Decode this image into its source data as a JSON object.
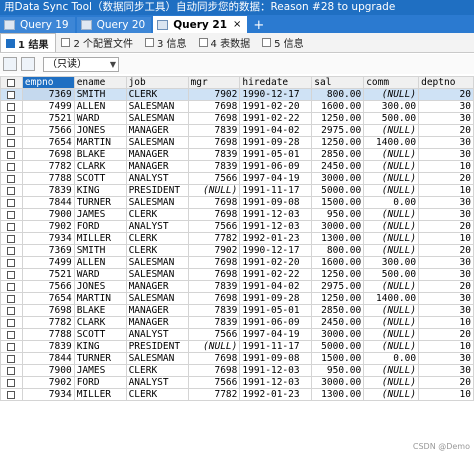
{
  "window": {
    "title": "用Data Sync Tool（数据同步工具）自动同步您的数据：Reason #28 to upgrade"
  },
  "query_tabs": [
    {
      "label": "Query 19",
      "active": false
    },
    {
      "label": "Query 20",
      "active": false
    },
    {
      "label": "Query 21",
      "active": true
    }
  ],
  "query_tab_close": "×",
  "query_tab_add": "+",
  "result_tabs": [
    {
      "label": "1 结果",
      "active": true
    },
    {
      "label": "2 个配置文件",
      "active": false
    },
    {
      "label": "3 信息",
      "active": false
    },
    {
      "label": "4 表数据",
      "active": false
    },
    {
      "label": "5 信息",
      "active": false
    }
  ],
  "toolbar": {
    "mode": "（只读）",
    "arrow": "▼"
  },
  "table": {
    "columns": [
      "empno",
      "ename",
      "job",
      "mgr",
      "hiredate",
      "sal",
      "comm",
      "deptno"
    ],
    "rows": [
      [
        "7369",
        "SMITH",
        "CLERK",
        "7902",
        "1990-12-17",
        "800.00",
        "(NULL)",
        "20"
      ],
      [
        "7499",
        "ALLEN",
        "SALESMAN",
        "7698",
        "1991-02-20",
        "1600.00",
        "300.00",
        "30"
      ],
      [
        "7521",
        "WARD",
        "SALESMAN",
        "7698",
        "1991-02-22",
        "1250.00",
        "500.00",
        "30"
      ],
      [
        "7566",
        "JONES",
        "MANAGER",
        "7839",
        "1991-04-02",
        "2975.00",
        "(NULL)",
        "20"
      ],
      [
        "7654",
        "MARTIN",
        "SALESMAN",
        "7698",
        "1991-09-28",
        "1250.00",
        "1400.00",
        "30"
      ],
      [
        "7698",
        "BLAKE",
        "MANAGER",
        "7839",
        "1991-05-01",
        "2850.00",
        "(NULL)",
        "30"
      ],
      [
        "7782",
        "CLARK",
        "MANAGER",
        "7839",
        "1991-06-09",
        "2450.00",
        "(NULL)",
        "10"
      ],
      [
        "7788",
        "SCOTT",
        "ANALYST",
        "7566",
        "1997-04-19",
        "3000.00",
        "(NULL)",
        "20"
      ],
      [
        "7839",
        "KING",
        "PRESIDENT",
        "(NULL)",
        "1991-11-17",
        "5000.00",
        "(NULL)",
        "10"
      ],
      [
        "7844",
        "TURNER",
        "SALESMAN",
        "7698",
        "1991-09-08",
        "1500.00",
        "0.00",
        "30"
      ],
      [
        "7900",
        "JAMES",
        "CLERK",
        "7698",
        "1991-12-03",
        "950.00",
        "(NULL)",
        "30"
      ],
      [
        "7902",
        "FORD",
        "ANALYST",
        "7566",
        "1991-12-03",
        "3000.00",
        "(NULL)",
        "20"
      ],
      [
        "7934",
        "MILLER",
        "CLERK",
        "7782",
        "1992-01-23",
        "1300.00",
        "(NULL)",
        "10"
      ],
      [
        "7369",
        "SMITH",
        "CLERK",
        "7902",
        "1990-12-17",
        "800.00",
        "(NULL)",
        "20"
      ],
      [
        "7499",
        "ALLEN",
        "SALESMAN",
        "7698",
        "1991-02-20",
        "1600.00",
        "300.00",
        "30"
      ],
      [
        "7521",
        "WARD",
        "SALESMAN",
        "7698",
        "1991-02-22",
        "1250.00",
        "500.00",
        "30"
      ],
      [
        "7566",
        "JONES",
        "MANAGER",
        "7839",
        "1991-04-02",
        "2975.00",
        "(NULL)",
        "20"
      ],
      [
        "7654",
        "MARTIN",
        "SALESMAN",
        "7698",
        "1991-09-28",
        "1250.00",
        "1400.00",
        "30"
      ],
      [
        "7698",
        "BLAKE",
        "MANAGER",
        "7839",
        "1991-05-01",
        "2850.00",
        "(NULL)",
        "30"
      ],
      [
        "7782",
        "CLARK",
        "MANAGER",
        "7839",
        "1991-06-09",
        "2450.00",
        "(NULL)",
        "10"
      ],
      [
        "7788",
        "SCOTT",
        "ANALYST",
        "7566",
        "1997-04-19",
        "3000.00",
        "(NULL)",
        "20"
      ],
      [
        "7839",
        "KING",
        "PRESIDENT",
        "(NULL)",
        "1991-11-17",
        "5000.00",
        "(NULL)",
        "10"
      ],
      [
        "7844",
        "TURNER",
        "SALESMAN",
        "7698",
        "1991-09-08",
        "1500.00",
        "0.00",
        "30"
      ],
      [
        "7900",
        "JAMES",
        "CLERK",
        "7698",
        "1991-12-03",
        "950.00",
        "(NULL)",
        "30"
      ],
      [
        "7902",
        "FORD",
        "ANALYST",
        "7566",
        "1991-12-03",
        "3000.00",
        "(NULL)",
        "20"
      ],
      [
        "7934",
        "MILLER",
        "CLERK",
        "7782",
        "1992-01-23",
        "1300.00",
        "(NULL)",
        "10"
      ]
    ]
  },
  "watermark": "CSDN @Demo"
}
